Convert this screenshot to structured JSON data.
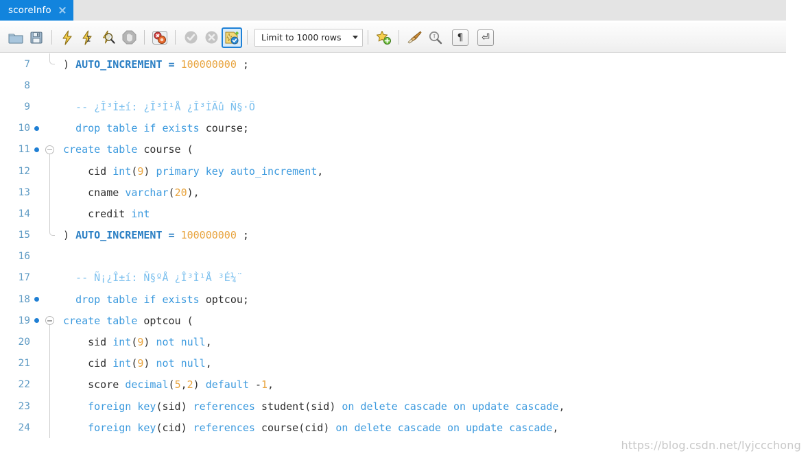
{
  "window": {
    "app": "MySQL Workbench SQL Editor"
  },
  "tabbar": {
    "tabs": [
      {
        "label": "scoreInfo",
        "active": true,
        "close_icon": "close-icon"
      }
    ]
  },
  "toolbar": {
    "buttons": [
      {
        "name": "open-sql-script-button",
        "icon": "folder-icon",
        "tooltip": "Open a SQL Script File",
        "selected": false
      },
      {
        "name": "save-script-button",
        "icon": "save-floppy-icon",
        "tooltip": "Save Script to File",
        "selected": false
      },
      {
        "name": "execute-statement-button",
        "icon": "lightning-icon",
        "tooltip": "Execute Statement",
        "selected": false
      },
      {
        "name": "execute-current-button",
        "icon": "lightning-cursor-icon",
        "tooltip": "Execute Current Statement",
        "selected": false
      },
      {
        "name": "explain-statement-button",
        "icon": "lightning-magnifier-icon",
        "tooltip": "Explain Current Statement",
        "selected": false
      },
      {
        "name": "stop-execution-button",
        "icon": "stop-hand-icon",
        "tooltip": "Stop the query being executed",
        "selected": false
      },
      {
        "name": "toggle-stop-on-error-button",
        "icon": "stop-on-error-icon",
        "tooltip": "Toggle whether execution should stop on errors",
        "selected": false
      },
      {
        "name": "commit-button",
        "icon": "commit-check-icon",
        "tooltip": "Commit",
        "selected": false
      },
      {
        "name": "rollback-button",
        "icon": "rollback-cross-icon",
        "tooltip": "Rollback",
        "selected": false
      },
      {
        "name": "toggle-autocommit-button",
        "icon": "autocommit-icon",
        "tooltip": "Toggle Auto-Commit Mode",
        "selected": true
      },
      {
        "name": "save-snippet-button",
        "icon": "star-plus-icon",
        "tooltip": "Save current statement to snippets",
        "selected": false
      },
      {
        "name": "beautify-sql-button",
        "icon": "brush-icon",
        "tooltip": "Beautify/reformat the SQL script",
        "selected": false
      },
      {
        "name": "find-button",
        "icon": "magnifier-icon",
        "tooltip": "Show the Find panel",
        "selected": false
      },
      {
        "name": "toggle-invisible-chars-button",
        "icon": "pilcrow-icon",
        "glyph": "¶",
        "tooltip": "Toggle invisible characters",
        "selected": false
      },
      {
        "name": "toggle-word-wrap-button",
        "icon": "wrap-arrow-icon",
        "glyph": "⏎",
        "tooltip": "Toggle wrapping of long lines",
        "selected": false
      }
    ],
    "limit_selector": {
      "label": "Limit to 1000 rows",
      "caret_icon": "chevron-down-icon"
    }
  },
  "editor": {
    "lines": [
      {
        "num": "7",
        "marker": false,
        "fold": "end",
        "tokens": [
          {
            "t": ") ",
            "c": "pun"
          },
          {
            "t": "AUTO_INCREMENT",
            "c": "kwb"
          },
          {
            "t": " = ",
            "c": "kwb"
          },
          {
            "t": "100000000",
            "c": "num"
          },
          {
            "t": " ;",
            "c": "pun"
          }
        ]
      },
      {
        "num": "8",
        "marker": false,
        "fold": "none",
        "tokens": []
      },
      {
        "num": "9",
        "marker": false,
        "fold": "none",
        "tokens": [
          {
            "t": "  -- ¿Î³Ì±í: ¿Î³Ì¹Å ¿Î³ÌÃû Ñ§·Ö",
            "c": "com"
          }
        ]
      },
      {
        "num": "10",
        "marker": true,
        "fold": "none",
        "tokens": [
          {
            "t": "  ",
            "c": "pun"
          },
          {
            "t": "drop",
            "c": "kw"
          },
          {
            "t": " ",
            "c": "pun"
          },
          {
            "t": "table",
            "c": "kw"
          },
          {
            "t": " ",
            "c": "pun"
          },
          {
            "t": "if",
            "c": "kw"
          },
          {
            "t": " ",
            "c": "pun"
          },
          {
            "t": "exists",
            "c": "kw"
          },
          {
            "t": " ",
            "c": "pun"
          },
          {
            "t": "course;",
            "c": "id"
          }
        ]
      },
      {
        "num": "11",
        "marker": true,
        "fold": "start",
        "tokens": [
          {
            "t": "create",
            "c": "kw"
          },
          {
            "t": " ",
            "c": "pun"
          },
          {
            "t": "table",
            "c": "kw"
          },
          {
            "t": " ",
            "c": "pun"
          },
          {
            "t": "course",
            "c": "id"
          },
          {
            "t": " (",
            "c": "pun"
          }
        ]
      },
      {
        "num": "12",
        "marker": false,
        "fold": "line",
        "tokens": [
          {
            "t": "    cid ",
            "c": "id"
          },
          {
            "t": "int",
            "c": "kw"
          },
          {
            "t": "(",
            "c": "pun"
          },
          {
            "t": "9",
            "c": "num"
          },
          {
            "t": ") ",
            "c": "pun"
          },
          {
            "t": "primary",
            "c": "kw"
          },
          {
            "t": " ",
            "c": "pun"
          },
          {
            "t": "key",
            "c": "kw"
          },
          {
            "t": " ",
            "c": "pun"
          },
          {
            "t": "auto_increment",
            "c": "kw"
          },
          {
            "t": ",",
            "c": "pun"
          }
        ]
      },
      {
        "num": "13",
        "marker": false,
        "fold": "line",
        "tokens": [
          {
            "t": "    cname ",
            "c": "id"
          },
          {
            "t": "varchar",
            "c": "kw"
          },
          {
            "t": "(",
            "c": "pun"
          },
          {
            "t": "20",
            "c": "num"
          },
          {
            "t": "),",
            "c": "pun"
          }
        ]
      },
      {
        "num": "14",
        "marker": false,
        "fold": "line",
        "tokens": [
          {
            "t": "    credit ",
            "c": "id"
          },
          {
            "t": "int",
            "c": "kw"
          }
        ]
      },
      {
        "num": "15",
        "marker": false,
        "fold": "end",
        "tokens": [
          {
            "t": ") ",
            "c": "pun"
          },
          {
            "t": "AUTO_INCREMENT",
            "c": "kwb"
          },
          {
            "t": " = ",
            "c": "kwb"
          },
          {
            "t": "100000000",
            "c": "num"
          },
          {
            "t": " ;",
            "c": "pun"
          }
        ]
      },
      {
        "num": "16",
        "marker": false,
        "fold": "none",
        "tokens": []
      },
      {
        "num": "17",
        "marker": false,
        "fold": "none",
        "tokens": [
          {
            "t": "  -- Ñ¡¿Î±í: Ñ§ºÅ ¿Î³Ì¹Å ³É¼¨",
            "c": "com"
          }
        ]
      },
      {
        "num": "18",
        "marker": true,
        "fold": "none",
        "tokens": [
          {
            "t": "  ",
            "c": "pun"
          },
          {
            "t": "drop",
            "c": "kw"
          },
          {
            "t": " ",
            "c": "pun"
          },
          {
            "t": "table",
            "c": "kw"
          },
          {
            "t": " ",
            "c": "pun"
          },
          {
            "t": "if",
            "c": "kw"
          },
          {
            "t": " ",
            "c": "pun"
          },
          {
            "t": "exists",
            "c": "kw"
          },
          {
            "t": " ",
            "c": "pun"
          },
          {
            "t": "optcou;",
            "c": "id"
          }
        ]
      },
      {
        "num": "19",
        "marker": true,
        "fold": "start",
        "tokens": [
          {
            "t": "create",
            "c": "kw"
          },
          {
            "t": " ",
            "c": "pun"
          },
          {
            "t": "table",
            "c": "kw"
          },
          {
            "t": " ",
            "c": "pun"
          },
          {
            "t": "optcou",
            "c": "id"
          },
          {
            "t": " (",
            "c": "pun"
          }
        ]
      },
      {
        "num": "20",
        "marker": false,
        "fold": "line",
        "tokens": [
          {
            "t": "    sid ",
            "c": "id"
          },
          {
            "t": "int",
            "c": "kw"
          },
          {
            "t": "(",
            "c": "pun"
          },
          {
            "t": "9",
            "c": "num"
          },
          {
            "t": ") ",
            "c": "pun"
          },
          {
            "t": "not",
            "c": "kw"
          },
          {
            "t": " ",
            "c": "pun"
          },
          {
            "t": "null",
            "c": "kw"
          },
          {
            "t": ",",
            "c": "pun"
          }
        ]
      },
      {
        "num": "21",
        "marker": false,
        "fold": "line",
        "tokens": [
          {
            "t": "    cid ",
            "c": "id"
          },
          {
            "t": "int",
            "c": "kw"
          },
          {
            "t": "(",
            "c": "pun"
          },
          {
            "t": "9",
            "c": "num"
          },
          {
            "t": ") ",
            "c": "pun"
          },
          {
            "t": "not",
            "c": "kw"
          },
          {
            "t": " ",
            "c": "pun"
          },
          {
            "t": "null",
            "c": "kw"
          },
          {
            "t": ",",
            "c": "pun"
          }
        ]
      },
      {
        "num": "22",
        "marker": false,
        "fold": "line",
        "tokens": [
          {
            "t": "    score ",
            "c": "id"
          },
          {
            "t": "decimal",
            "c": "kw"
          },
          {
            "t": "(",
            "c": "pun"
          },
          {
            "t": "5",
            "c": "num"
          },
          {
            "t": ",",
            "c": "pun"
          },
          {
            "t": "2",
            "c": "num"
          },
          {
            "t": ") ",
            "c": "pun"
          },
          {
            "t": "default",
            "c": "kw"
          },
          {
            "t": " -",
            "c": "pun"
          },
          {
            "t": "1",
            "c": "num"
          },
          {
            "t": ",",
            "c": "pun"
          }
        ]
      },
      {
        "num": "23",
        "marker": false,
        "fold": "line",
        "tokens": [
          {
            "t": "    ",
            "c": "pun"
          },
          {
            "t": "foreign",
            "c": "kw"
          },
          {
            "t": " ",
            "c": "pun"
          },
          {
            "t": "key",
            "c": "kw"
          },
          {
            "t": "(",
            "c": "pun"
          },
          {
            "t": "sid",
            "c": "id"
          },
          {
            "t": ") ",
            "c": "pun"
          },
          {
            "t": "references",
            "c": "kw"
          },
          {
            "t": " ",
            "c": "pun"
          },
          {
            "t": "student",
            "c": "id"
          },
          {
            "t": "(",
            "c": "pun"
          },
          {
            "t": "sid",
            "c": "id"
          },
          {
            "t": ") ",
            "c": "pun"
          },
          {
            "t": "on",
            "c": "kw"
          },
          {
            "t": " ",
            "c": "pun"
          },
          {
            "t": "delete",
            "c": "kw"
          },
          {
            "t": " ",
            "c": "pun"
          },
          {
            "t": "cascade",
            "c": "kw"
          },
          {
            "t": " ",
            "c": "pun"
          },
          {
            "t": "on",
            "c": "kw"
          },
          {
            "t": " ",
            "c": "pun"
          },
          {
            "t": "update",
            "c": "kw"
          },
          {
            "t": " ",
            "c": "pun"
          },
          {
            "t": "cascade",
            "c": "kw"
          },
          {
            "t": ",",
            "c": "pun"
          }
        ]
      },
      {
        "num": "24",
        "marker": false,
        "fold": "line",
        "tokens": [
          {
            "t": "    ",
            "c": "pun"
          },
          {
            "t": "foreign",
            "c": "kw"
          },
          {
            "t": " ",
            "c": "pun"
          },
          {
            "t": "key",
            "c": "kw"
          },
          {
            "t": "(",
            "c": "pun"
          },
          {
            "t": "cid",
            "c": "id"
          },
          {
            "t": ") ",
            "c": "pun"
          },
          {
            "t": "references",
            "c": "kw"
          },
          {
            "t": " ",
            "c": "pun"
          },
          {
            "t": "course",
            "c": "id"
          },
          {
            "t": "(",
            "c": "pun"
          },
          {
            "t": "cid",
            "c": "id"
          },
          {
            "t": ") ",
            "c": "pun"
          },
          {
            "t": "on",
            "c": "kw"
          },
          {
            "t": " ",
            "c": "pun"
          },
          {
            "t": "delete",
            "c": "kw"
          },
          {
            "t": " ",
            "c": "pun"
          },
          {
            "t": "cascade",
            "c": "kw"
          },
          {
            "t": " ",
            "c": "pun"
          },
          {
            "t": "on",
            "c": "kw"
          },
          {
            "t": " ",
            "c": "pun"
          },
          {
            "t": "update",
            "c": "kw"
          },
          {
            "t": " ",
            "c": "pun"
          },
          {
            "t": "cascade",
            "c": "kw"
          },
          {
            "t": ",",
            "c": "pun"
          }
        ]
      }
    ]
  },
  "watermark": {
    "text": "https://blog.csdn.net/lyjccchong"
  },
  "colors": {
    "tab_active": "#1284dd",
    "accent_underline": "#1284dd",
    "keyword": "#3c9ade",
    "number": "#e8a33d",
    "comment": "#7cc0ee",
    "identifier": "#2e2e2e",
    "gutter_number": "#5f9bc4",
    "marker_dot": "#1f7fd4"
  }
}
